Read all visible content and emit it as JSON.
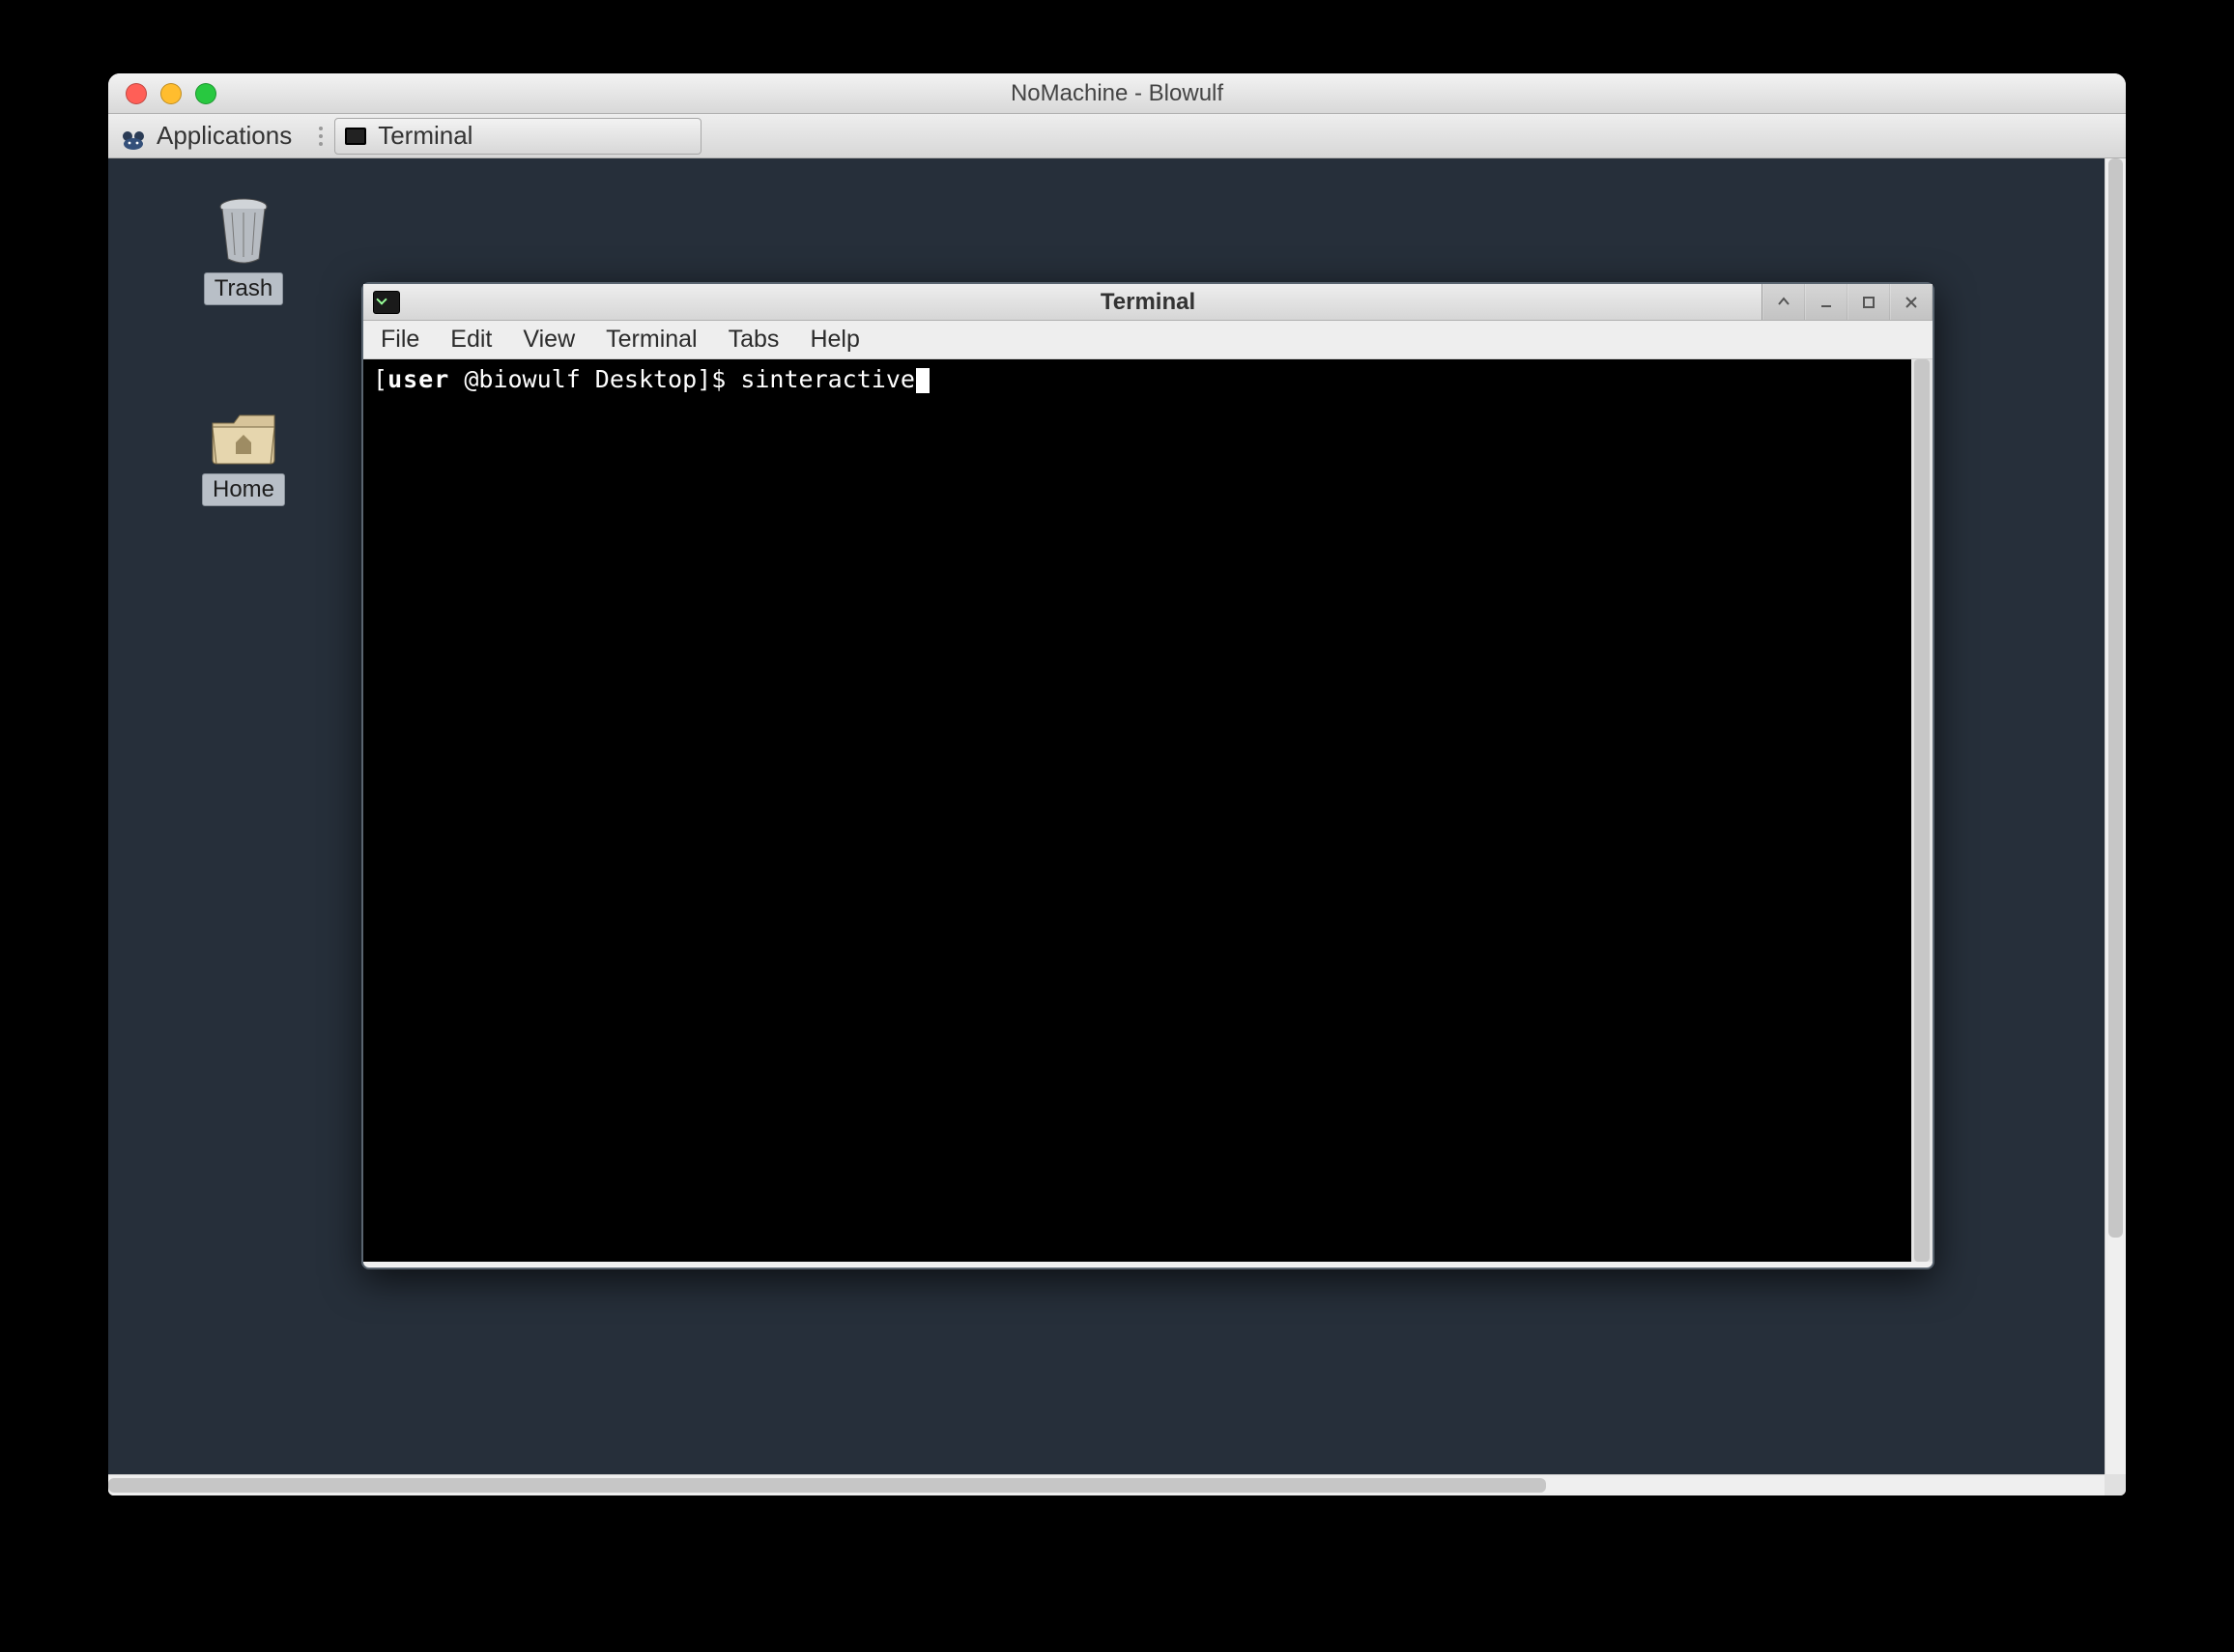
{
  "mac_window": {
    "title": "NoMachine - Blowulf"
  },
  "taskbar": {
    "applications_label": "Applications",
    "task_terminal_label": "Terminal"
  },
  "desktop_icons": {
    "trash_label": "Trash",
    "home_label": "Home"
  },
  "terminal": {
    "title": "Terminal",
    "menu": {
      "file": "File",
      "edit": "Edit",
      "view": "View",
      "terminal": "Terminal",
      "tabs": "Tabs",
      "help": "Help"
    },
    "prompt_open": "[",
    "prompt_user": "user",
    "prompt_rest": "@biowulf Desktop]$ ",
    "command": "sinteractive"
  }
}
